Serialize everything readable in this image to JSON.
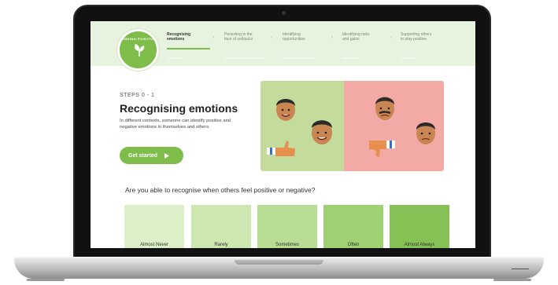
{
  "header": {
    "logo_text": "FINDING POSITIVE",
    "nav": [
      {
        "label": "Recognising\nemotions",
        "active": true
      },
      {
        "label": "Persisting in the\nface of setbacks",
        "active": false
      },
      {
        "label": "Identifying\nopportunities",
        "active": false
      },
      {
        "label": "Identifying risks\nand gains",
        "active": false
      },
      {
        "label": "Supporting others\nto stay positive",
        "active": false
      }
    ]
  },
  "main": {
    "steps": "STEPS 0 - 1",
    "title": "Recognising emotions",
    "description": "In different contexts, someone can identify positive and negative emotions in themselves and others.",
    "cta_label": "Get started",
    "cta_icon": "play-triangle-icon"
  },
  "quiz": {
    "question": "Are you able to recognise when others feel positive or negative?",
    "options": [
      {
        "label": "Almost Never",
        "color": "#dcefc8"
      },
      {
        "label": "Rarely",
        "color": "#cde7b1"
      },
      {
        "label": "Sometimes",
        "color": "#b8dc93"
      },
      {
        "label": "Often",
        "color": "#9fd071"
      },
      {
        "label": "Almost Always",
        "color": "#86c155"
      }
    ]
  },
  "colors": {
    "brand": "#7fbd4a",
    "header_bg": "#e8f3df",
    "positive_panel": "#c3dc9b",
    "negative_panel": "#f3aaa7"
  }
}
